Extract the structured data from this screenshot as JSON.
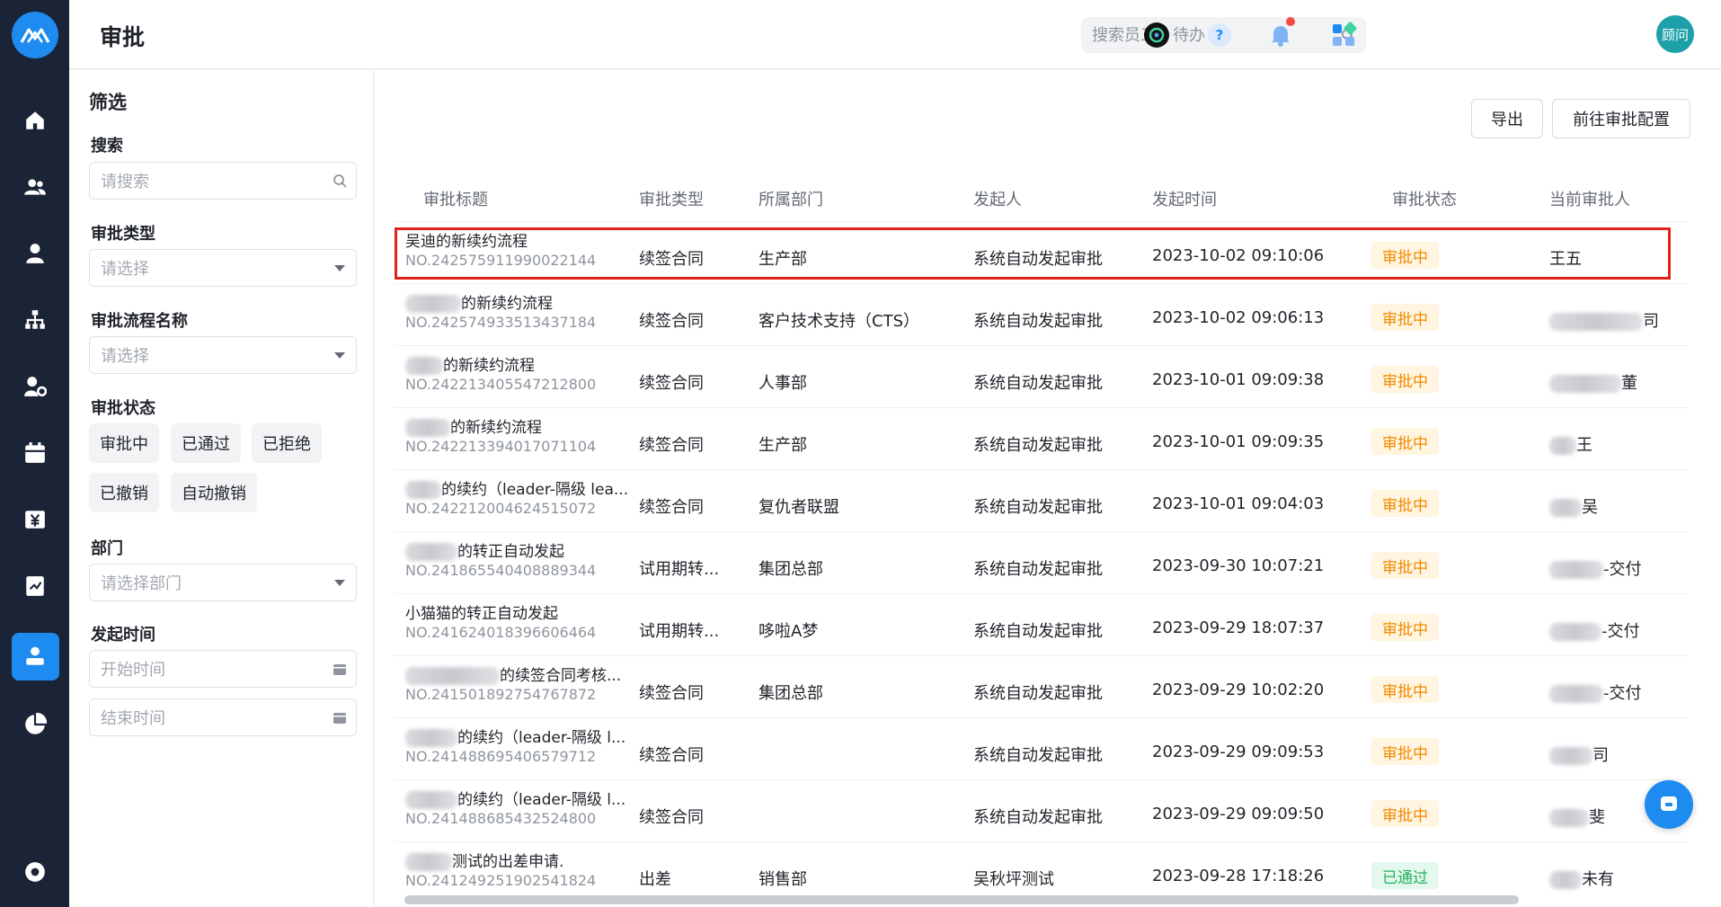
{
  "header": {
    "title": "审批",
    "search_placeholder": "搜索员工、待办",
    "avatar_label": "顾问"
  },
  "filters": {
    "title": "筛选",
    "search_label": "搜索",
    "search_placeholder": "请搜索",
    "type_label": "审批类型",
    "type_placeholder": "请选择",
    "flow_label": "审批流程名称",
    "flow_placeholder": "请选择",
    "status_label": "审批状态",
    "status_chips": [
      "审批中",
      "已通过",
      "已拒绝",
      "已撤销",
      "自动撤销"
    ],
    "dept_label": "部门",
    "dept_placeholder": "请选择部门",
    "time_label": "发起时间",
    "start_placeholder": "开始时间",
    "end_placeholder": "结束时间"
  },
  "toolbar": {
    "export_label": "导出",
    "config_label": "前往审批配置"
  },
  "table": {
    "columns": [
      "审批标题",
      "审批类型",
      "所属部门",
      "发起人",
      "发起时间",
      "审批状态",
      "当前审批人"
    ],
    "rows": [
      {
        "title": "吴迪的新续约流程",
        "no": "NO.242575911990022144",
        "type": "续签合同",
        "dept": "生产部",
        "initiator": "系统自动发起审批",
        "time": "2023-10-02 09:10:06",
        "status": "审批中",
        "approver": "王五"
      },
      {
        "title": "的新续约流程",
        "no": "NO.242574933513437184",
        "type": "续签合同",
        "dept": "客户技术支持（CTS）",
        "initiator": "系统自动发起审批",
        "time": "2023-10-02 09:06:13",
        "status": "审批中",
        "approver": "司"
      },
      {
        "title": "的新续约流程",
        "no": "NO.242213405547212800",
        "type": "续签合同",
        "dept": "人事部",
        "initiator": "系统自动发起审批",
        "time": "2023-10-01 09:09:38",
        "status": "审批中",
        "approver": "董"
      },
      {
        "title": "的新续约流程",
        "no": "NO.242213394017071104",
        "type": "续签合同",
        "dept": "生产部",
        "initiator": "系统自动发起审批",
        "time": "2023-10-01 09:09:35",
        "status": "审批中",
        "approver": "王"
      },
      {
        "title": "的续约（leader-隔级 lea...",
        "no": "NO.242212004624515072",
        "type": "续签合同",
        "dept": "复仇者联盟",
        "initiator": "系统自动发起审批",
        "time": "2023-10-01 09:04:03",
        "status": "审批中",
        "approver": "吴"
      },
      {
        "title": "的转正自动发起",
        "no": "NO.241865540408889344",
        "type": "试用期转...",
        "dept": "集团总部",
        "initiator": "系统自动发起审批",
        "time": "2023-09-30 10:07:21",
        "status": "审批中",
        "approver": "-交付"
      },
      {
        "title": "小猫猫的转正自动发起",
        "no": "NO.241624018396606464",
        "type": "试用期转...",
        "dept": "哆啦A梦",
        "initiator": "系统自动发起审批",
        "time": "2023-09-29 18:07:37",
        "status": "审批中",
        "approver": "-交付"
      },
      {
        "title": "的续签合同考核...",
        "no": "NO.241501892754767872",
        "type": "续签合同",
        "dept": "集团总部",
        "initiator": "系统自动发起审批",
        "time": "2023-09-29 10:02:20",
        "status": "审批中",
        "approver": "-交付"
      },
      {
        "title": "的续约（leader-隔级 l...",
        "no": "NO.241488695406579712",
        "type": "续签合同",
        "dept": "",
        "initiator": "系统自动发起审批",
        "time": "2023-09-29 09:09:53",
        "status": "审批中",
        "approver": "司"
      },
      {
        "title": "的续约（leader-隔级 l...",
        "no": "NO.241488685432524800",
        "type": "续签合同",
        "dept": "",
        "initiator": "系统自动发起审批",
        "time": "2023-09-29 09:09:50",
        "status": "审批中",
        "approver": "斐"
      },
      {
        "title": "测试的出差申请.",
        "no": "NO.241249251902541824",
        "type": "出差",
        "dept": "销售部",
        "initiator": "吴秋坪测试",
        "time": "2023-09-28 17:18:26",
        "status": "已通过",
        "approver": "未有"
      }
    ]
  },
  "icons": {
    "rail": [
      "logo-icon",
      "home-icon",
      "team-icon",
      "person-icon",
      "org-chart-icon",
      "user-settings-icon",
      "calendar-icon",
      "salary-icon",
      "report-icon",
      "approval-icon",
      "pie-chart-icon",
      "settings-icon"
    ],
    "header": [
      "search-icon",
      "ai-assistant-icon",
      "help-icon",
      "bell-icon",
      "apps-grid-icon"
    ]
  },
  "colors": {
    "accent": "#1e8bf0",
    "rail_bg": "#1b2336",
    "pending": "#f08a00",
    "passed": "#1fb35b",
    "highlight": "#e2231a"
  }
}
